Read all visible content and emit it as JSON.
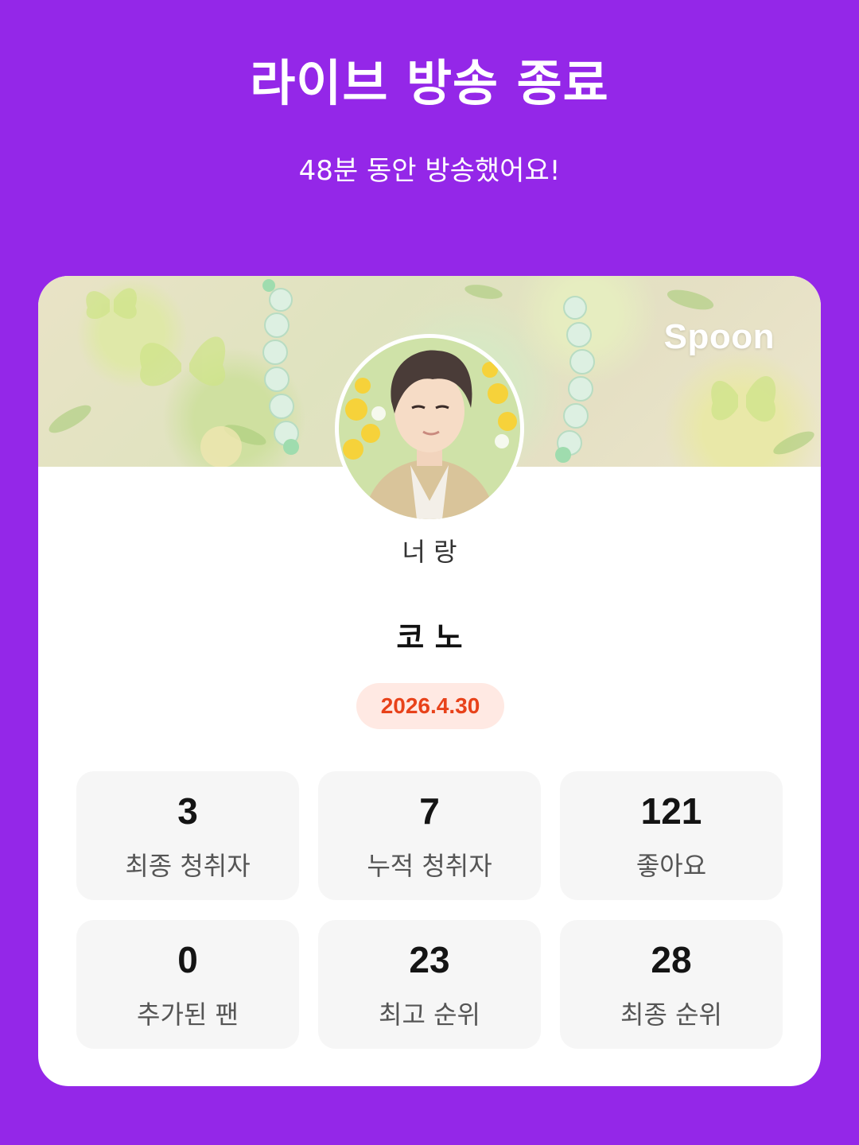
{
  "header": {
    "title": "라이브 방송 종료",
    "subtitle": "48분 동안 방송했어요!"
  },
  "card": {
    "brand": "Spoon",
    "live_title": "너 랑",
    "host_name": "코 노",
    "date": "2026.4.30",
    "stats": [
      {
        "value": "3",
        "label": "최종 청취자"
      },
      {
        "value": "7",
        "label": "누적 청취자"
      },
      {
        "value": "121",
        "label": "좋아요"
      },
      {
        "value": "0",
        "label": "추가된 팬"
      },
      {
        "value": "23",
        "label": "최고 순위"
      },
      {
        "value": "28",
        "label": "최종 순위"
      }
    ]
  },
  "colors": {
    "background": "#9427e8",
    "date_badge_bg": "#ffe9e3",
    "date_badge_text": "#e8421a"
  }
}
